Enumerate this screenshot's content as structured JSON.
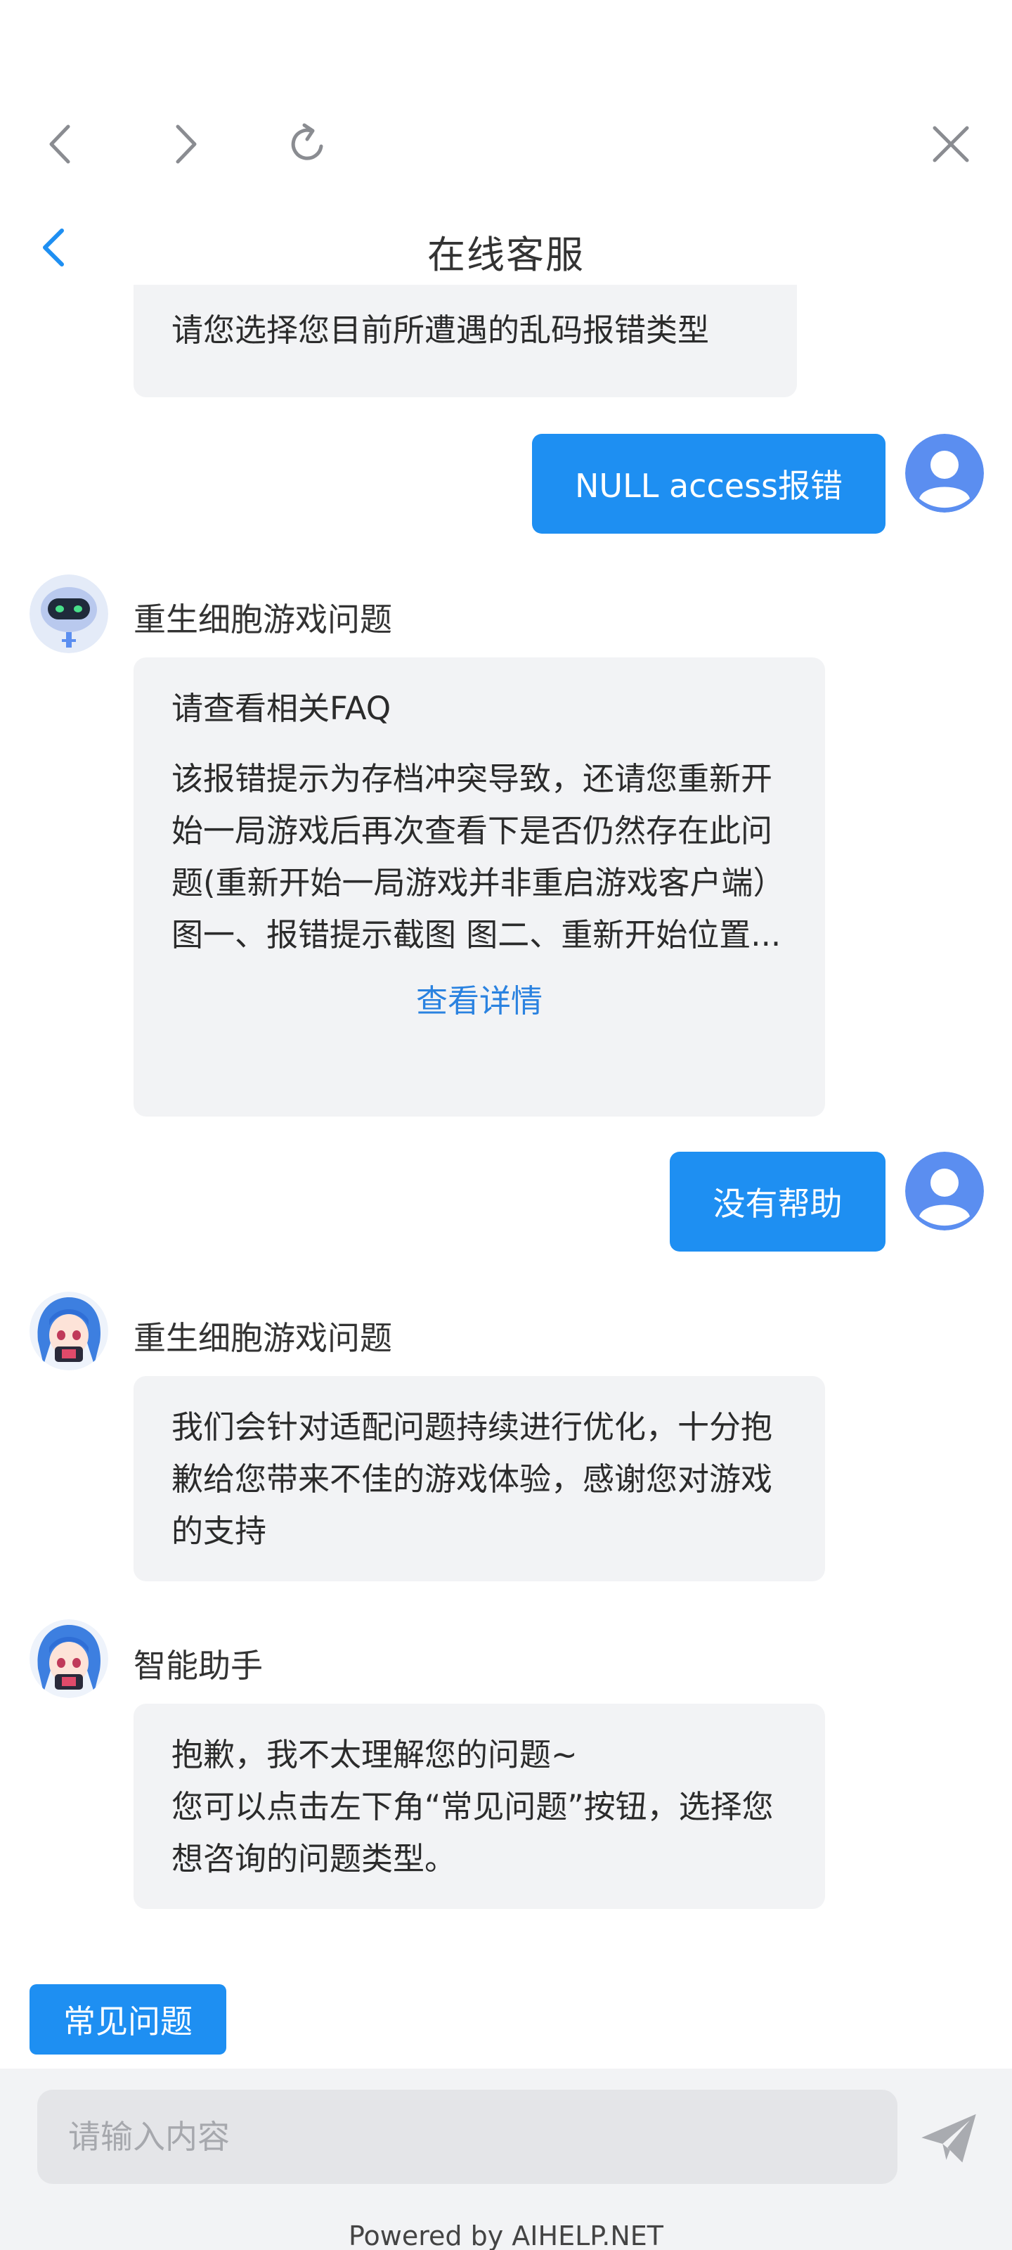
{
  "header": {
    "title": "在线客服"
  },
  "messages": {
    "m1": {
      "text": "请您选择您目前所遭遇的乱码报错类型"
    },
    "m2": {
      "text": "NULL access报错"
    },
    "m3": {
      "sender": "重生细胞游戏问题",
      "faq_title": "请查看相关FAQ",
      "body": "该报错提示为存档冲突导致，还请您重新开始一局游戏后再次查看下是否仍然存在此问题(重新开始一局游戏并非重启游戏客户端） 图一、报错提示截图 图二、重新开始位置...",
      "link": "查看详情"
    },
    "m4": {
      "text": "没有帮助"
    },
    "m5": {
      "sender": "重生细胞游戏问题",
      "text": "我们会针对适配问题持续进行优化，十分抱歉给您带来不佳的游戏体验，感谢您对游戏的支持"
    },
    "m6": {
      "sender": "智能助手",
      "line1": "抱歉，我不太理解您的问题~",
      "line2": "您可以点击左下角“常见问题”按钮，选择您想咨询的问题类型。"
    }
  },
  "quick": {
    "common_label": "常见问题"
  },
  "input": {
    "placeholder": "请输入内容"
  },
  "footer": {
    "powered": "Powered by AIHELP.NET"
  },
  "colors": {
    "accent": "#1e8ff2",
    "bubble_in": "#f2f3f5",
    "link": "#2a82e0"
  },
  "icons": [
    "chevron-left-icon",
    "chevron-right-icon",
    "refresh-icon",
    "close-icon",
    "back-icon",
    "user-avatar-icon",
    "bot-avatar",
    "anime-avatar",
    "send-icon"
  ]
}
